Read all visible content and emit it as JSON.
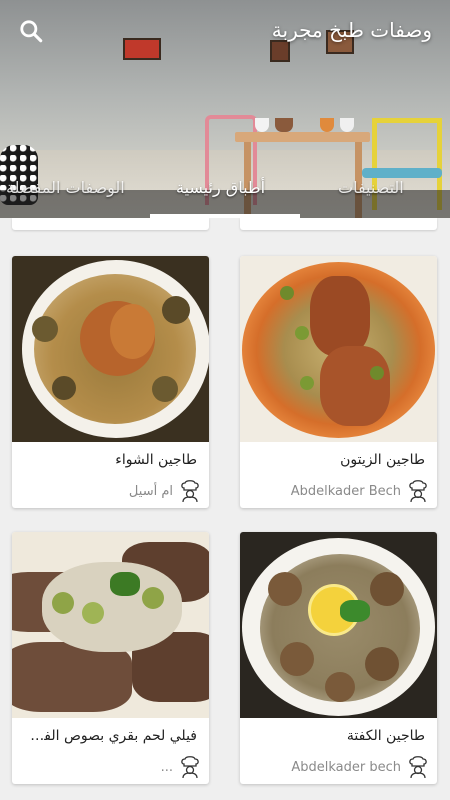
{
  "header": {
    "title": "وصفات طبخ مجربة",
    "search_icon": "search-icon"
  },
  "tabs": [
    {
      "label": "التصنيفات",
      "active": false
    },
    {
      "label": "أطباق رئيسية",
      "active": true
    },
    {
      "label": "الوصفات المفضلة",
      "active": false
    }
  ],
  "recipes": [
    {
      "name": "طاجين الزيتون",
      "author": "Abdelkader Bech"
    },
    {
      "name": "طاجين الشواء",
      "author": "ام أسيل"
    },
    {
      "name": "طاجين الكفتة",
      "author": "Abdelkader bech"
    },
    {
      "name": "فيلي لحم بقري بصوص الفطر و ا...",
      "author": "..."
    }
  ],
  "colors": {
    "header_text": "#ffffff",
    "card_bg": "#ffffff",
    "page_bg": "#efefef",
    "author_text": "#8a8a8a"
  }
}
